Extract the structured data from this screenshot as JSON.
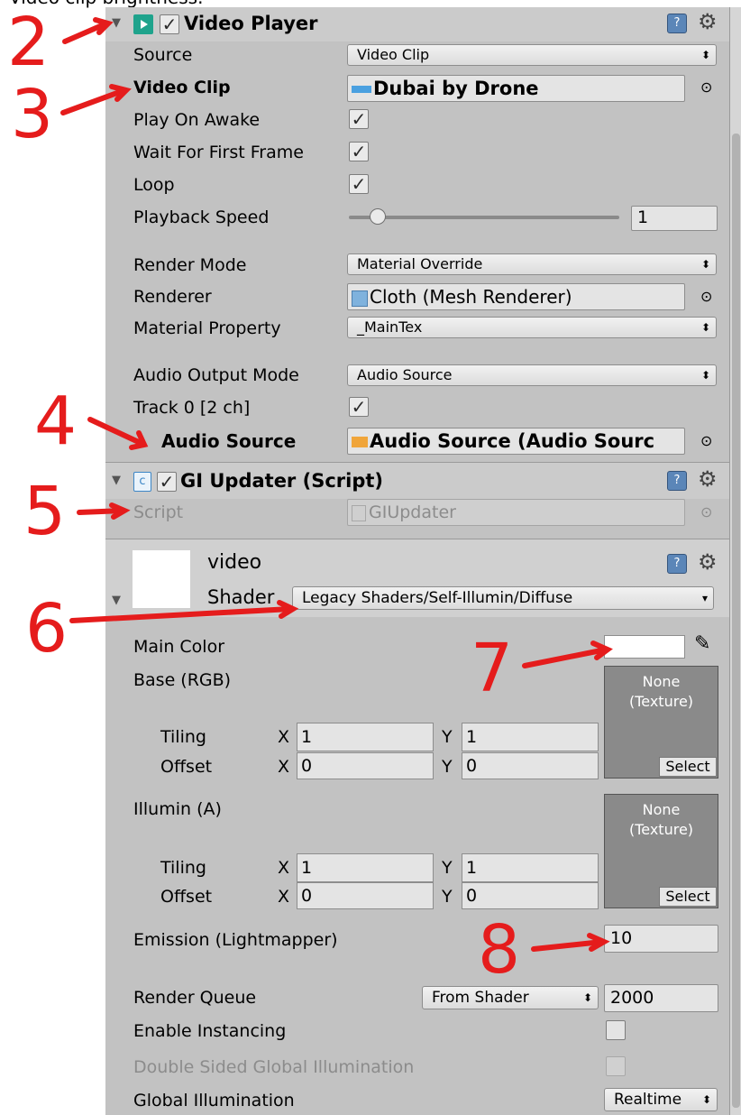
{
  "top_fragment": "Video clip brightness.",
  "video_player": {
    "title": "Video Player",
    "enabled": true,
    "source_label": "Source",
    "source_value": "Video Clip",
    "clip_label": "Video Clip",
    "clip_value": "Dubai by Drone",
    "play_on_awake_label": "Play On Awake",
    "play_on_awake": true,
    "wait_first_frame_label": "Wait For First Frame",
    "wait_first_frame": true,
    "loop_label": "Loop",
    "loop": true,
    "speed_label": "Playback Speed",
    "speed_value": "1",
    "speed_fraction": 0.1,
    "render_mode_label": "Render Mode",
    "render_mode_value": "Material Override",
    "renderer_label": "Renderer",
    "renderer_value": "Cloth (Mesh Renderer)",
    "material_property_label": "Material Property",
    "material_property_value": "_MainTex",
    "audio_output_label": "Audio Output Mode",
    "audio_output_value": "Audio Source",
    "track_label": "Track 0 [2 ch]",
    "track_enabled": true,
    "audio_source_label": "Audio Source",
    "audio_source_value": "Audio Source (Audio Sourc"
  },
  "gi_updater": {
    "title": "GI Updater (Script)",
    "script_label": "Script",
    "script_value": "GIUpdater"
  },
  "material": {
    "name": "video",
    "shader_label": "Shader",
    "shader_value": "Legacy Shaders/Self-Illumin/Diffuse",
    "main_color_label": "Main Color",
    "base_label": "Base (RGB)",
    "tiling_label": "Tiling",
    "offset_label": "Offset",
    "x_label": "X",
    "y_label": "Y",
    "base_tiling_x": "1",
    "base_tiling_y": "1",
    "base_offset_x": "0",
    "base_offset_y": "0",
    "illumin_label": "Illumin (A)",
    "illum_tiling_x": "1",
    "illum_tiling_y": "1",
    "illum_offset_x": "0",
    "illum_offset_y": "0",
    "texture_none": "None",
    "texture_type": "(Texture)",
    "select_label": "Select",
    "emission_label": "Emission (Lightmapper)",
    "emission_value": "10",
    "render_queue_label": "Render Queue",
    "render_queue_mode": "From Shader",
    "render_queue_value": "2000",
    "instancing_label": "Enable Instancing",
    "double_sided_label": "Double Sided Global Illumination",
    "gi_label": "Global Illumination",
    "gi_value": "Realtime"
  },
  "annotations": [
    "2",
    "3",
    "4",
    "5",
    "6",
    "7",
    "8"
  ],
  "colors": {
    "panel": "#c2c2c2",
    "annotation": "#e51c1c"
  }
}
